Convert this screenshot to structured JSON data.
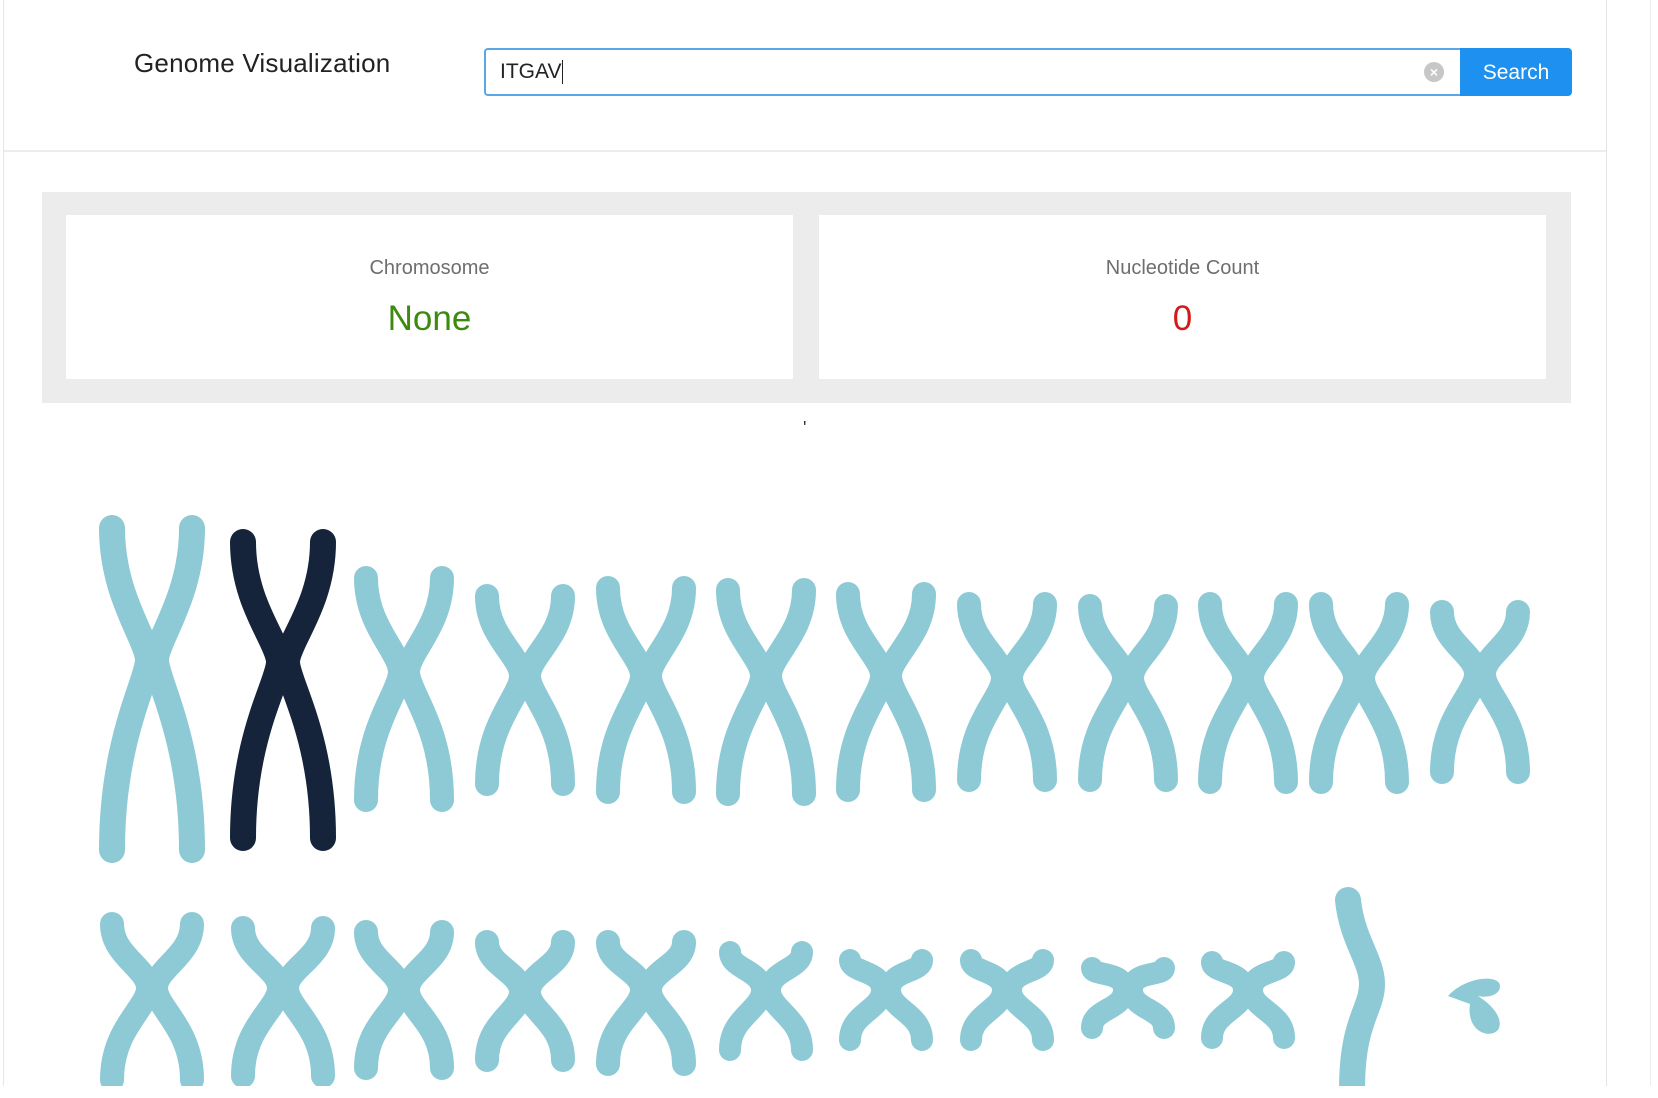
{
  "app": {
    "title": "Genome Visualization"
  },
  "search": {
    "value": "ITGAV",
    "button_label": "Search"
  },
  "stats": {
    "chromosome": {
      "label": "Chromosome",
      "value": "None",
      "color": "#3d8a0e"
    },
    "nucleotide_count": {
      "label": "Nucleotide Count",
      "value": "0",
      "color": "#d21a1a"
    }
  },
  "stray_text": "'",
  "karyotype": {
    "default_color": "#8ecad6",
    "highlight_color": "#15243a",
    "highlighted_index": 1,
    "count": 24
  }
}
